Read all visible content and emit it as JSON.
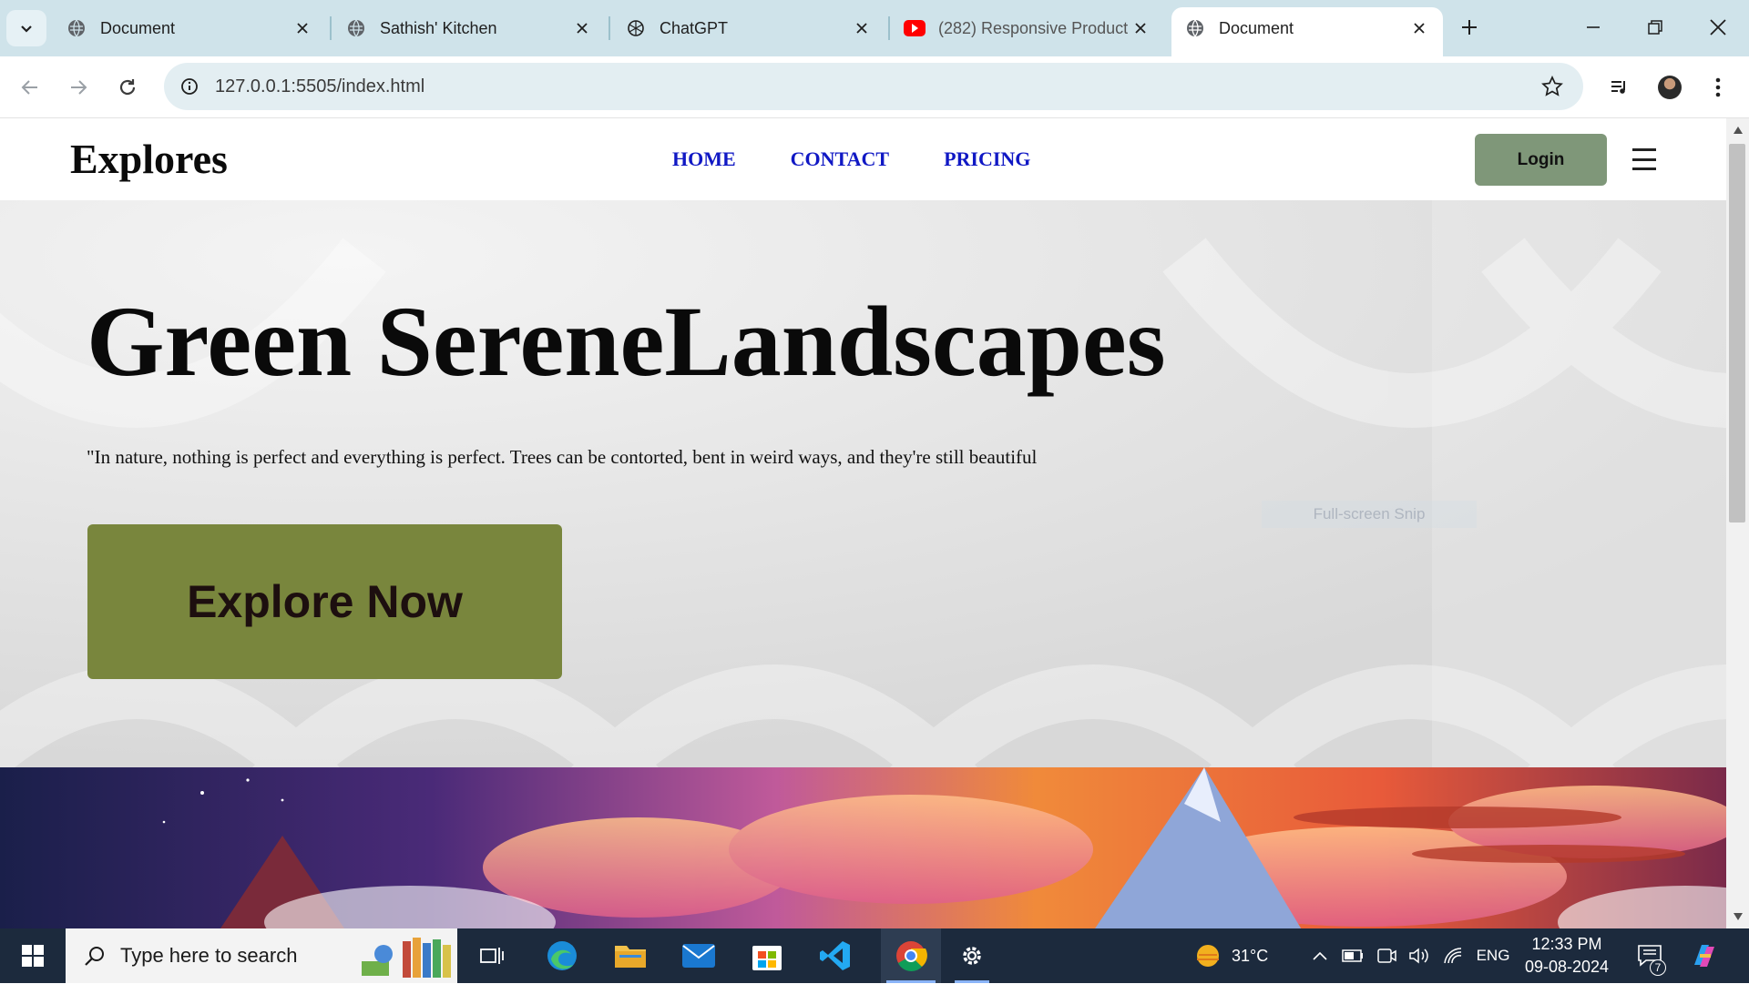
{
  "browser": {
    "tabs": [
      {
        "title": "Document",
        "icon": "globe-icon"
      },
      {
        "title": "Sathish' Kitchen",
        "icon": "globe-icon"
      },
      {
        "title": "ChatGPT",
        "icon": "chatgpt-icon"
      },
      {
        "title": "(282) Responsive Product",
        "icon": "youtube-icon"
      },
      {
        "title": "Document",
        "icon": "globe-icon",
        "active": true
      }
    ],
    "url": "127.0.0.1:5505/index.html"
  },
  "site": {
    "logo": "Explores",
    "menu": [
      "HOME",
      "CONTACT",
      "PRICING"
    ],
    "login_label": "Login"
  },
  "hero": {
    "title": "Green SereneLandscapes",
    "quote": "\"In nature, nothing is perfect and everything is perfect. Trees can be contorted, bent in weird ways, and they're still beautiful",
    "cta_label": "Explore Now",
    "overlay_text": "Full-screen Snip"
  },
  "taskbar": {
    "search_placeholder": "Type here to search",
    "weather": "31°C",
    "language": "ENG",
    "time": "12:33 PM",
    "date": "09-08-2024",
    "notification_count": "7"
  },
  "colors": {
    "accent_cta": "#79863d",
    "login_bg": "#7f9779",
    "nav_link": "#1018c4",
    "tabbar_bg": "#cfe3ea"
  }
}
